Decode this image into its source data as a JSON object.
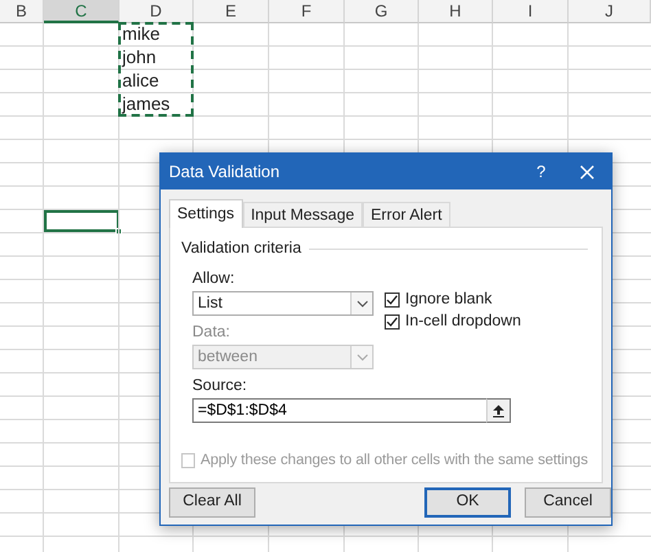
{
  "spreadsheet": {
    "columns": [
      {
        "label": "B",
        "selected": false
      },
      {
        "label": "C",
        "selected": true
      },
      {
        "label": "D",
        "selected": false
      },
      {
        "label": "E",
        "selected": false
      },
      {
        "label": "F",
        "selected": false
      },
      {
        "label": "G",
        "selected": false
      },
      {
        "label": "H",
        "selected": false
      },
      {
        "label": "I",
        "selected": false
      },
      {
        "label": "J",
        "selected": false
      }
    ],
    "rows": [
      {
        "selected": false,
        "cells": {
          "D": {
            "text": "mike",
            "copied": true
          }
        }
      },
      {
        "selected": false,
        "cells": {
          "D": {
            "text": "john",
            "copied": true
          }
        }
      },
      {
        "selected": false,
        "cells": {
          "D": {
            "text": "alice",
            "copied": true
          }
        }
      },
      {
        "selected": false,
        "cells": {
          "D": {
            "text": "james",
            "copied": true
          }
        }
      },
      {
        "selected": false
      },
      {
        "selected": false
      },
      {
        "selected": false
      },
      {
        "selected": false
      },
      {
        "selected": true
      },
      {
        "selected": false
      },
      {
        "selected": false
      },
      {
        "selected": false
      },
      {
        "selected": false
      },
      {
        "selected": false
      },
      {
        "selected": false
      },
      {
        "selected": false
      },
      {
        "selected": false
      },
      {
        "selected": false
      },
      {
        "selected": false
      },
      {
        "selected": false
      },
      {
        "selected": false
      },
      {
        "selected": false
      }
    ]
  },
  "dialog": {
    "title": "Data Validation",
    "help_button": "?",
    "tabs": [
      {
        "label": "Settings",
        "selected": true
      },
      {
        "label": "Input Message",
        "selected": false
      },
      {
        "label": "Error Alert",
        "selected": false
      }
    ],
    "section_title": "Validation criteria",
    "allow": {
      "label": "Allow:",
      "value": "List",
      "disabled": false
    },
    "data": {
      "label": "Data:",
      "value": "between",
      "disabled": true
    },
    "checkboxes": [
      {
        "label": "Ignore blank",
        "checked": true,
        "disabled": false
      },
      {
        "label": "In-cell dropdown",
        "checked": true,
        "disabled": false
      }
    ],
    "source": {
      "label": "Source:",
      "value": "=$D$1:$D$4"
    },
    "apply_all": {
      "label": "Apply these changes to all other cells with the same settings",
      "checked": false,
      "disabled": true
    },
    "buttons": [
      {
        "label": "Clear All",
        "kind": "left"
      },
      {
        "label": "OK",
        "kind": "default"
      },
      {
        "label": "Cancel",
        "kind": "normal"
      }
    ]
  }
}
